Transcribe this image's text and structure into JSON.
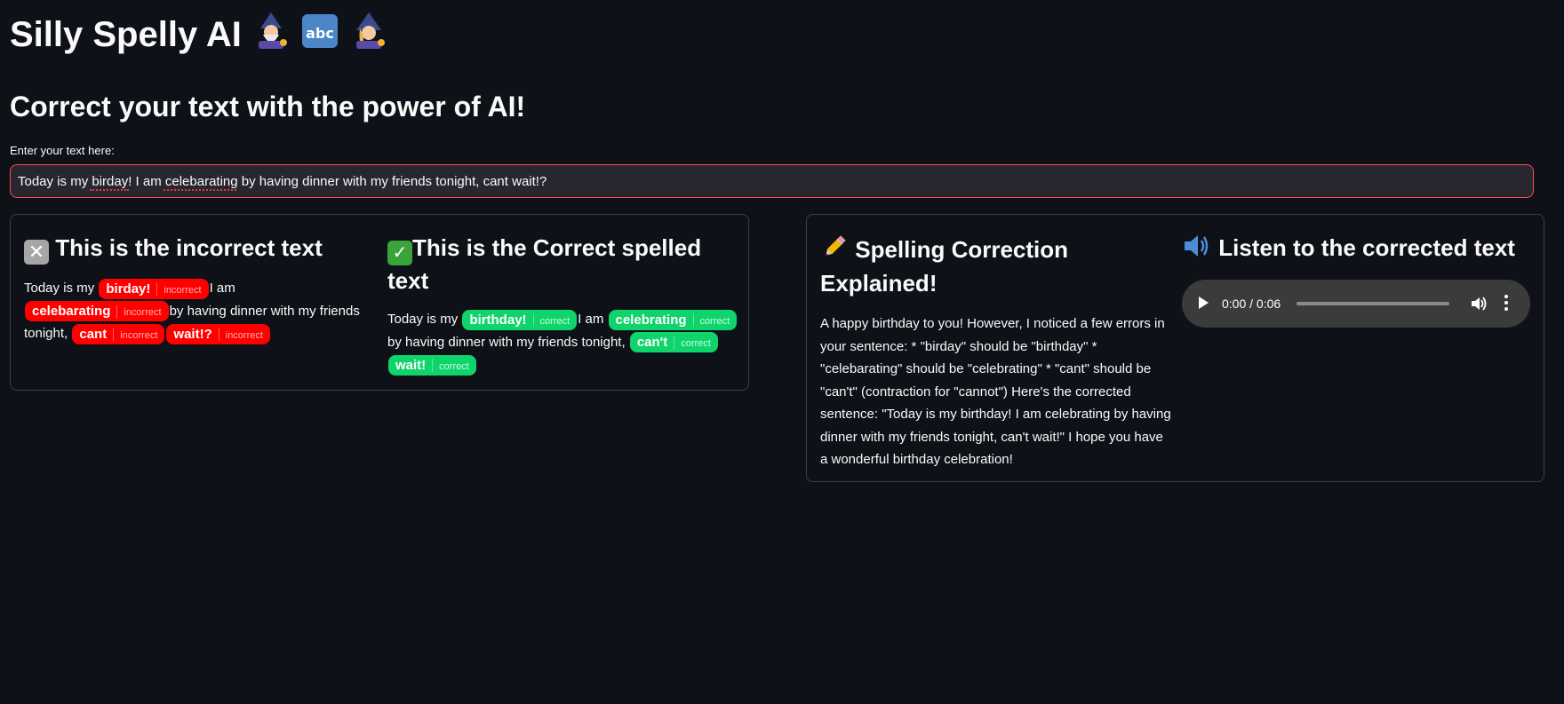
{
  "header": {
    "title": "Silly Spelly AI",
    "title_emojis": [
      "mage-man-icon",
      "abc-input-icon",
      "mage-woman-icon"
    ],
    "subtitle": "Correct your text with the power of AI!"
  },
  "input": {
    "label": "Enter your text here:",
    "value": "Today is my birday! I am celebarating by having dinner with my friends tonight, cant wait!?"
  },
  "incorrect_panel": {
    "heading": "This is the incorrect text",
    "icon": "cross-mark-icon",
    "segments": [
      {
        "kind": "text",
        "text": "Today is my "
      },
      {
        "kind": "chip",
        "word": "birday!",
        "tag": "incorrect"
      },
      {
        "kind": "text",
        "text": "I am "
      },
      {
        "kind": "chip",
        "word": "celebarating",
        "tag": "incorrect"
      },
      {
        "kind": "text",
        "text": "by having dinner with my friends tonight, "
      },
      {
        "kind": "chip",
        "word": "cant",
        "tag": "incorrect"
      },
      {
        "kind": "chip",
        "word": "wait!?",
        "tag": "incorrect"
      }
    ]
  },
  "correct_panel": {
    "heading": "This is the Correct spelled text",
    "icon": "check-mark-icon",
    "segments": [
      {
        "kind": "text",
        "text": "Today is my "
      },
      {
        "kind": "chip",
        "word": "birthday!",
        "tag": "correct"
      },
      {
        "kind": "text",
        "text": "I am "
      },
      {
        "kind": "chip",
        "word": "celebrating",
        "tag": "correct"
      },
      {
        "kind": "text",
        "text": " by having dinner with my friends tonight, "
      },
      {
        "kind": "chip",
        "word": "can't",
        "tag": "correct"
      },
      {
        "kind": "chip",
        "word": "wait!",
        "tag": "correct"
      }
    ]
  },
  "explanation_panel": {
    "heading": "Spelling Correction Explained!",
    "icon": "pencil-icon",
    "body": "A happy birthday to you! However, I noticed a few errors in your sentence: * \"birday\" should be \"birthday\" * \"celebarating\" should be \"celebrating\" * \"cant\" should be \"can't\" (contraction for \"cannot\") Here's the corrected sentence: \"Today is my birthday! I am celebrating by having dinner with my friends tonight, can't wait!\" I hope you have a wonderful birthday celebration!"
  },
  "listen_panel": {
    "heading": "Listen to the corrected text",
    "icon": "speaker-icon",
    "audio": {
      "time": "0:00 / 0:06",
      "progress": 0
    }
  },
  "colors": {
    "background": "#0e1117",
    "incorrect": "#ff0000",
    "correct": "#0fd46c",
    "input_border": "#ff4b4b"
  }
}
